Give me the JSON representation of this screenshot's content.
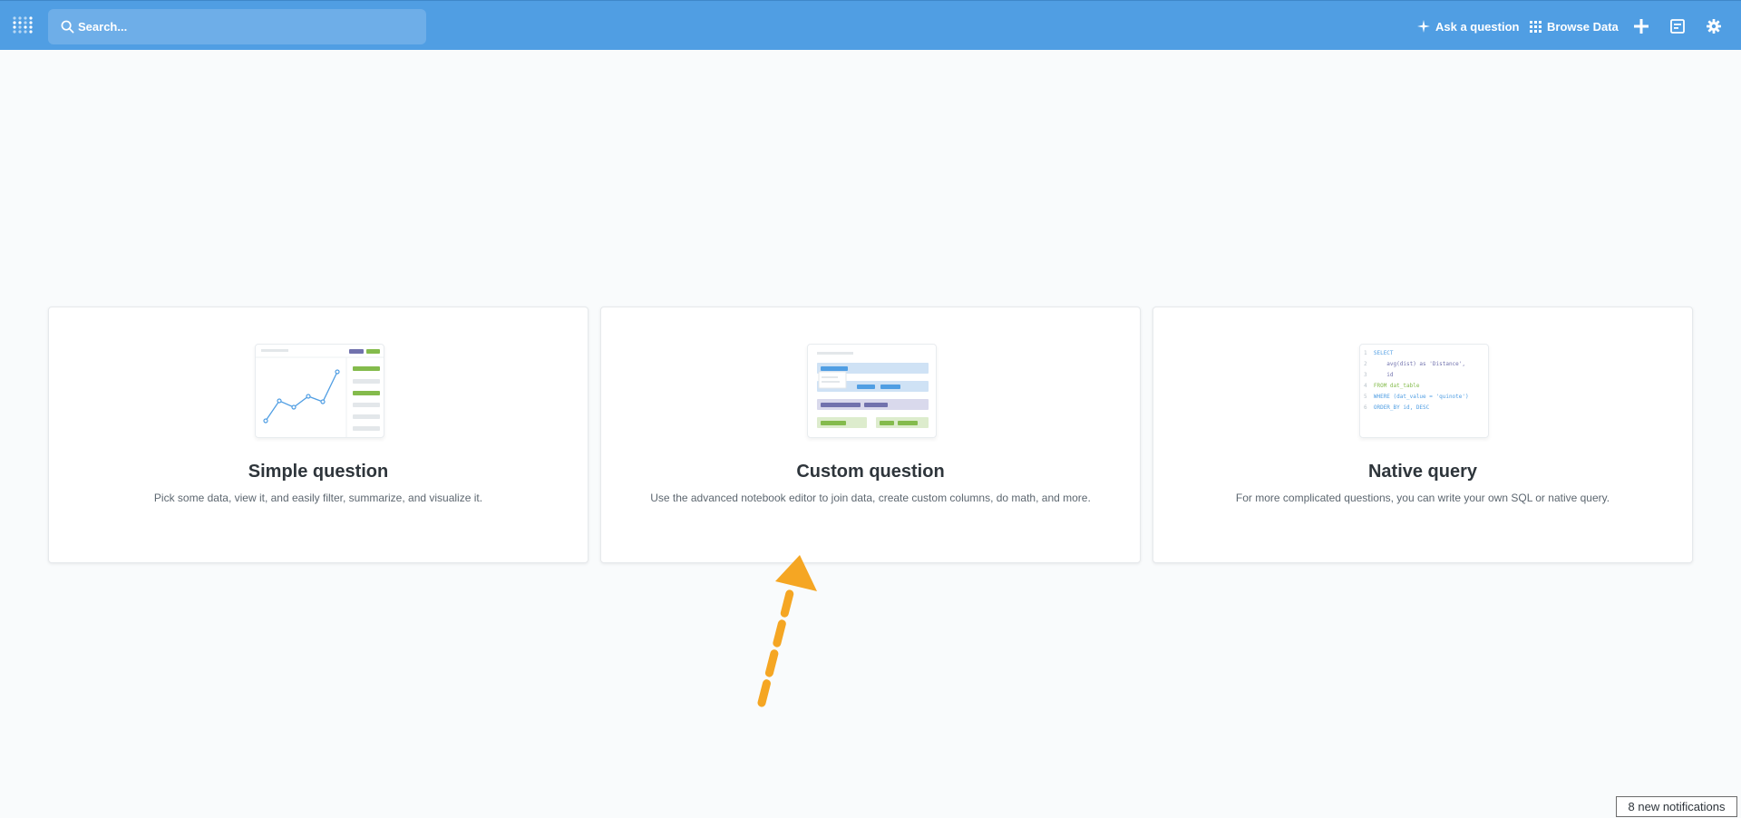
{
  "nav": {
    "search_placeholder": "Search...",
    "ask_question_label": "Ask a question",
    "browse_data_label": "Browse Data",
    "accent_color": "#509ee3",
    "icons": [
      "metabase-logo-icon",
      "search-icon",
      "sparkle-icon",
      "grid-icon",
      "plus-icon",
      "bookmark-icon",
      "gear-icon"
    ]
  },
  "cards": [
    {
      "title": "Simple question",
      "description": "Pick some data, view it, and easily filter, summarize, and visualize it."
    },
    {
      "title": "Custom question",
      "description": "Use the advanced notebook editor to join data, create custom columns, do math, and more."
    },
    {
      "title": "Native query",
      "description": "For more complicated questions, you can write your own SQL or native query.",
      "code_lines": [
        {
          "n": "1",
          "text": "SELECT"
        },
        {
          "n": "2",
          "text": "    avg(dist) as 'Distance',"
        },
        {
          "n": "3",
          "text": "    id"
        },
        {
          "n": "4",
          "text": "FROM dat_table"
        },
        {
          "n": "5",
          "text": "WHERE (dat_value = 'quinote')"
        },
        {
          "n": "6",
          "text": "ORDER_BY id, DESC"
        }
      ]
    }
  ],
  "notifications": {
    "label": "8 new notifications"
  },
  "annotation": {
    "arrow_color": "#f5a623"
  }
}
